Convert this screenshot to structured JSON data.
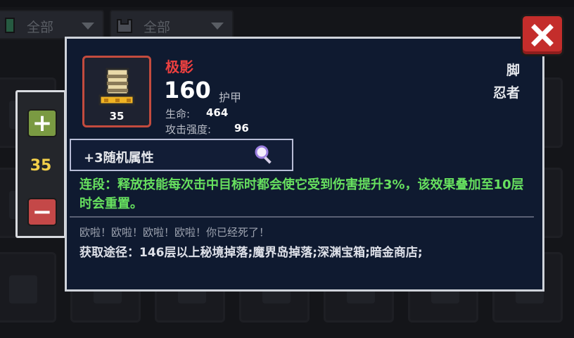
{
  "filters": [
    {
      "label": "全部"
    },
    {
      "label": "全部"
    }
  ],
  "quantity": {
    "value": "35"
  },
  "tooltip": {
    "item_name": "极影",
    "item_level": "35",
    "main_value": "160",
    "main_label": "护甲",
    "stats": [
      {
        "label": "生命:",
        "value": "464"
      },
      {
        "label": "攻击强度:",
        "value": "96"
      }
    ],
    "slot_type": "脚",
    "slot_class": "忍者",
    "random_attr": "+3随机属性",
    "skill": "连段：释放技能每次击中目标时都会使它受到伤害提升3%，该效果叠加至10层时会重置。",
    "flavor": "欧啦！欧啦！欧啦！欧啦！你已经死了！",
    "source": "获取途径：146层以上秘境掉落;魔界岛掉落;深渊宝箱;暗金商店;"
  },
  "colors": {
    "item_name": "#ec4040",
    "skill_text": "#67e05f",
    "quantity": "#f2cf4a",
    "close_button": "#c42d2b"
  },
  "icons": [
    "filter-gem-icon",
    "filter-helmet-icon",
    "close-icon",
    "plus-icon",
    "minus-icon",
    "boots-item-icon",
    "magnifier-icon"
  ]
}
